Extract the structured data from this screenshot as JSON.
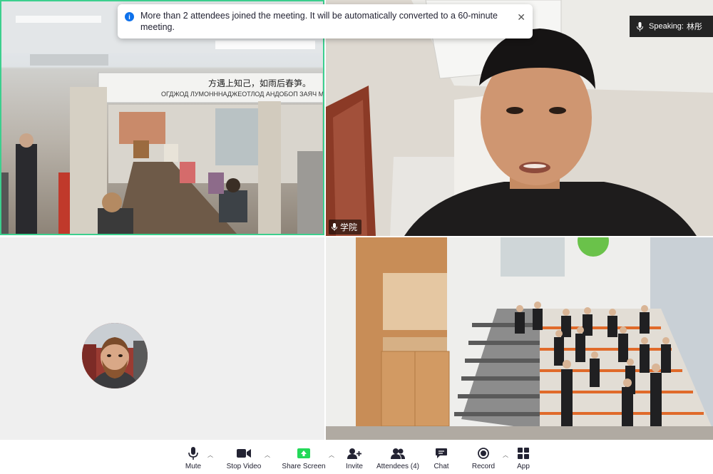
{
  "notification": {
    "message": "More than 2 attendees joined the meeting. It will be automatically converted to a 60-minute meeting."
  },
  "speaking": {
    "label": "Speaking:",
    "name": "林彤"
  },
  "tiles": {
    "room_banner_cn": "方遇上知己，如雨后春笋。",
    "room_banner_ru": "ОГДЖОД ЛУМОНННАДЖЕОТЛОД АНДОБОП ЗАЯЧ МОННАЛ В",
    "speaker_name": "学院"
  },
  "colors": {
    "active_border": "#3ccf8e",
    "notice_icon": "#0e71eb",
    "share_green": "#23d959"
  },
  "toolbar": {
    "items": [
      {
        "label": "Mute",
        "icon": "microphone-icon",
        "caret": true
      },
      {
        "label": "Stop Video",
        "icon": "video-camera-icon",
        "caret": true
      },
      {
        "label": "Share Screen",
        "icon": "share-screen-icon",
        "caret": true
      },
      {
        "label": "Invite",
        "icon": "add-user-icon",
        "caret": false
      },
      {
        "label": "Attendees (4)",
        "icon": "attendees-icon",
        "caret": false
      },
      {
        "label": "Chat",
        "icon": "chat-icon",
        "caret": false
      },
      {
        "label": "Record",
        "icon": "record-icon",
        "caret": true
      },
      {
        "label": "App",
        "icon": "apps-grid-icon",
        "caret": false
      }
    ]
  }
}
